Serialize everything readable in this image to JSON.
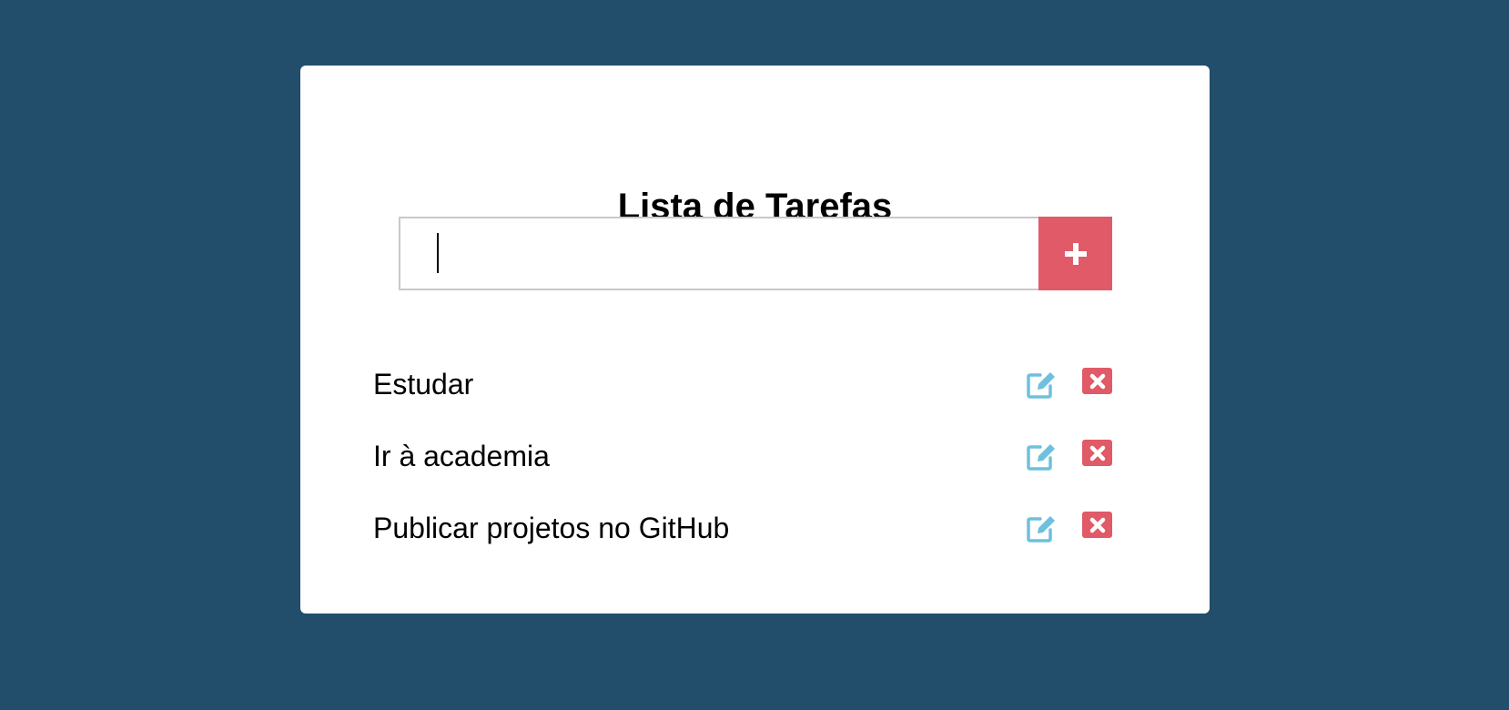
{
  "app": {
    "title": "Lista de Tarefas"
  },
  "input": {
    "value": "",
    "placeholder": ""
  },
  "add_button": {
    "icon": "plus-icon"
  },
  "tasks": [
    {
      "text": "Estudar"
    },
    {
      "text": "Ir à academia"
    },
    {
      "text": "Publicar projetos no GitHub"
    }
  ],
  "colors": {
    "background": "#224e6c",
    "card": "#ffffff",
    "accent_red": "#e05a68",
    "accent_blue": "#6ec0de",
    "input_border": "#c9c9c9"
  },
  "icons": {
    "edit": "edit-icon",
    "delete": "delete-icon"
  }
}
